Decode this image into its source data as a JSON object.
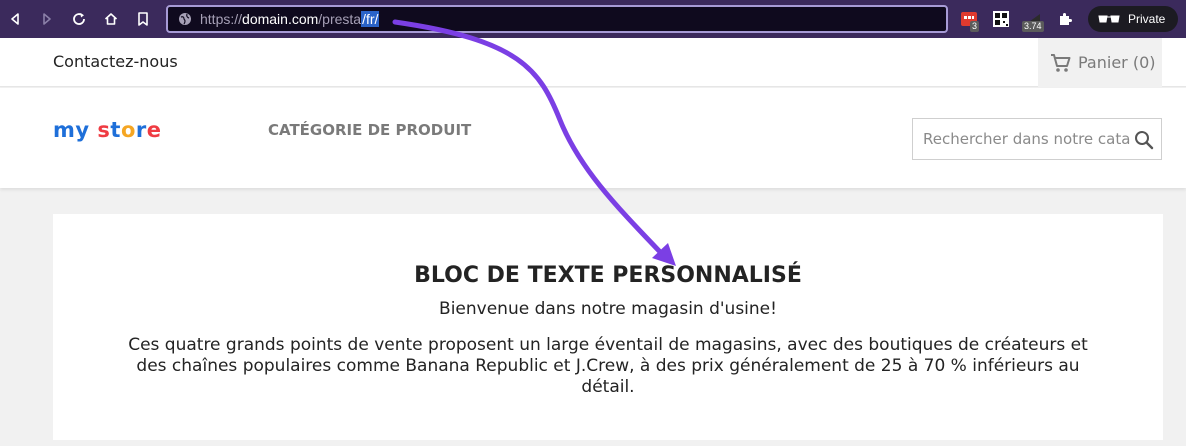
{
  "browser": {
    "url": {
      "protocol": "https://",
      "host": "domain.com",
      "path": "/presta",
      "selected": "/fr/"
    },
    "extensions": [
      {
        "name": "todo-ext-icon",
        "badge": "3",
        "color": "#e03a2f"
      },
      {
        "name": "qr-code-icon",
        "badge": "",
        "color": "#ffffff"
      },
      {
        "name": "dark-ext-icon",
        "badge": "3.74",
        "color": "#2b2b2b"
      },
      {
        "name": "puzzle-icon",
        "badge": "",
        "color": "#ffffff"
      }
    ],
    "private_label": "Private"
  },
  "site": {
    "contact_label": "Contactez-nous",
    "cart_label": "Panier (0)",
    "logo": {
      "letters": [
        {
          "ch": "m",
          "color": "#1e6fd9"
        },
        {
          "ch": "y",
          "color": "#1e6fd9"
        },
        {
          "ch": " ",
          "color": "#1e6fd9"
        },
        {
          "ch": "s",
          "color": "#ef3b42"
        },
        {
          "ch": "t",
          "color": "#1e6fd9"
        },
        {
          "ch": "o",
          "color": "#f5a623"
        },
        {
          "ch": "r",
          "color": "#1e6fd9"
        },
        {
          "ch": "e",
          "color": "#ef3b42"
        }
      ]
    },
    "category_label": "CATÉGORIE DE PRODUIT",
    "search_placeholder": "Rechercher dans notre catalogue"
  },
  "content": {
    "title": "BLOC DE TEXTE PERSONNALISÉ",
    "welcome": "Bienvenue dans notre magasin d'usine!",
    "description": "Ces quatre grands points de vente proposent un large éventail de magasins, avec des boutiques de créateurs et des chaînes populaires comme Banana Republic et J.Crew, à des prix généralement de 25 à 70 % inférieurs au détail."
  },
  "colors": {
    "browser_bar": "#3b2a5c",
    "annotation_arrow": "#7b3fe4"
  }
}
